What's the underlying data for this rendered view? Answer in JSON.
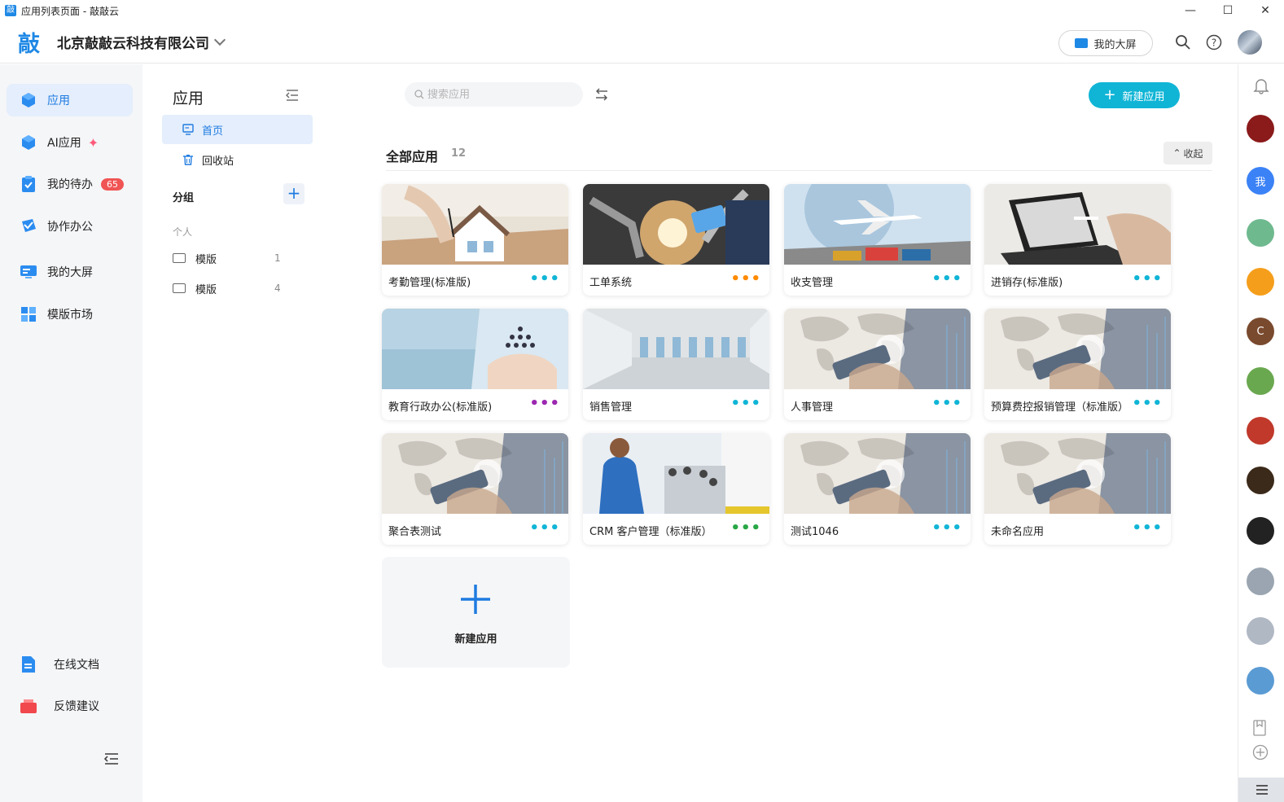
{
  "window": {
    "title": "应用列表页面 - 敲敲云",
    "app_icon": "敲"
  },
  "header": {
    "logo": "敲",
    "company": "北京敲敲云科技有限公司",
    "screen_button": "我的大屏"
  },
  "leftnav": {
    "items": [
      {
        "label": "应用"
      },
      {
        "label": "AI应用"
      },
      {
        "label": "我的待办",
        "badge": "65"
      },
      {
        "label": "协作办公"
      },
      {
        "label": "我的大屏"
      },
      {
        "label": "模版市场"
      }
    ],
    "bottom": [
      {
        "label": "在线文档"
      },
      {
        "label": "反馈建议"
      }
    ]
  },
  "panel": {
    "title": "应用",
    "items": [
      {
        "label": "首页"
      },
      {
        "label": "回收站"
      }
    ],
    "group_label": "分组",
    "personal_label": "个人",
    "folders": [
      {
        "label": "模版",
        "count": "1"
      },
      {
        "label": "模版",
        "count": "4"
      }
    ]
  },
  "main": {
    "search_placeholder": "搜索应用",
    "new_button": "新建应用",
    "all_title": "全部应用",
    "all_count": "12",
    "fold_label": "收起",
    "apps": [
      {
        "name": "考勤管理(标准版)",
        "dots_color": "#10b5d6",
        "image": "house"
      },
      {
        "name": "工单系统",
        "dots_color": "#ff8a00",
        "image": "robot"
      },
      {
        "name": "收支管理",
        "dots_color": "#10b5d6",
        "image": "plane"
      },
      {
        "name": "进销存(标准版)",
        "dots_color": "#10b5d6",
        "image": "laptop"
      },
      {
        "name": "教育行政办公(标准版)",
        "dots_color": "#9c27b0",
        "image": "people"
      },
      {
        "name": "销售管理",
        "dots_color": "#10b5d6",
        "image": "hall"
      },
      {
        "name": "人事管理",
        "dots_color": "#10b5d6",
        "image": "map"
      },
      {
        "name": "预算费控报销管理（标准版）",
        "dots_color": "#10b5d6",
        "image": "map"
      },
      {
        "name": "聚合表测试",
        "dots_color": "#10b5d6",
        "image": "map"
      },
      {
        "name": "CRM 客户管理（标准版）",
        "dots_color": "#27a745",
        "image": "meeting"
      },
      {
        "name": "测试1046",
        "dots_color": "#10b5d6",
        "image": "map"
      },
      {
        "name": "未命名应用",
        "dots_color": "#10b5d6",
        "image": "map"
      }
    ],
    "add_card_label": "新建应用"
  },
  "rail": {
    "avatars": [
      {
        "text": "",
        "color": "#8b1a1a"
      },
      {
        "text": "我",
        "color": "#3b82f6"
      },
      {
        "text": "",
        "color": "#6fb98f"
      },
      {
        "text": "",
        "color": "#f59e1b"
      },
      {
        "text": "C",
        "color": "#7a4a2e"
      },
      {
        "text": "",
        "color": "#6aa84f"
      },
      {
        "text": "",
        "color": "#c0392b"
      },
      {
        "text": "",
        "color": "#3b2a1a"
      },
      {
        "text": "",
        "color": "#222222"
      },
      {
        "text": "",
        "color": "#9aa5b1"
      },
      {
        "text": "",
        "color": "#b0b8c4"
      },
      {
        "text": "",
        "color": "#5a9bd4"
      }
    ]
  },
  "colors": {
    "accent": "#1e88e5",
    "primary_btn": "#10b5d6",
    "badge": "#f05454"
  }
}
